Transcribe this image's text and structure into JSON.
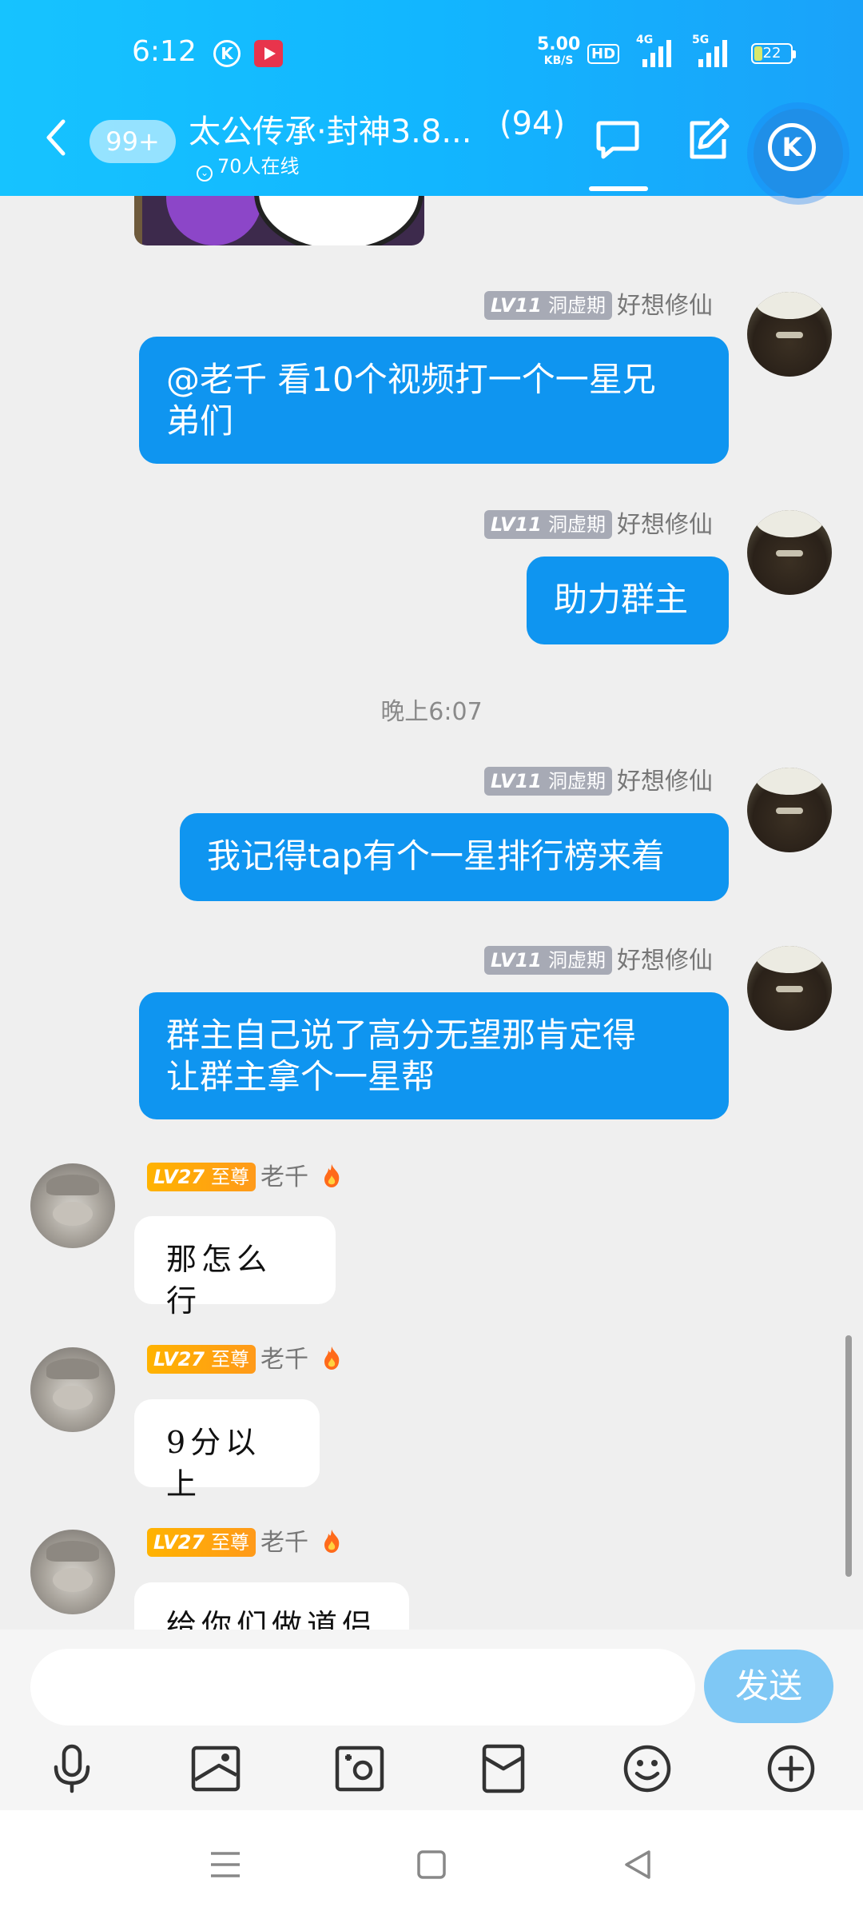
{
  "status_bar": {
    "time": "6:12",
    "net_speed_value": "5.00",
    "net_speed_unit": "KB/S",
    "hd_label": "HD",
    "signal1_label": "4G",
    "signal2_label": "5G",
    "battery": "22"
  },
  "header": {
    "unread_badge": "99+",
    "group_title": "太公传承·封神3.8...",
    "member_count": "(94)",
    "online_text": "70人在线"
  },
  "messages": [
    {
      "level": "LV11",
      "rank": "洞虚期",
      "sender": "好想修仙",
      "text_lines": [
        "@老千 看10个视频打一个一星兄",
        "弟们"
      ]
    },
    {
      "level": "LV11",
      "rank": "洞虚期",
      "sender": "好想修仙",
      "text_lines": [
        "助力群主"
      ]
    },
    {
      "level": "LV11",
      "rank": "洞虚期",
      "sender": "好想修仙",
      "text_lines": [
        "我记得tap有个一星排行榜来着"
      ]
    },
    {
      "level": "LV11",
      "rank": "洞虚期",
      "sender": "好想修仙",
      "text_lines": [
        "群主自己说了高分无望那肯定得",
        "让群主拿个一星帮"
      ]
    },
    {
      "level": "LV27",
      "rank": "至尊",
      "sender": "老千",
      "text_lines": [
        "那怎么行"
      ]
    },
    {
      "level": "LV27",
      "rank": "至尊",
      "sender": "老千",
      "text_lines": [
        "9分以上"
      ]
    },
    {
      "level": "LV27",
      "rank": "至尊",
      "sender": "老千",
      "text_lines": [
        "给你们做道侣"
      ]
    }
  ],
  "time_separator": "晚上6:07",
  "input": {
    "value": "",
    "placeholder": "",
    "send_label": "发送"
  },
  "colors": {
    "header": "#12b6ff",
    "outgoing_bubble": "#0f95f0",
    "send_button": "#7fc8f5",
    "level_gray": "#a7aab5",
    "level_gold": "#ffb300"
  }
}
